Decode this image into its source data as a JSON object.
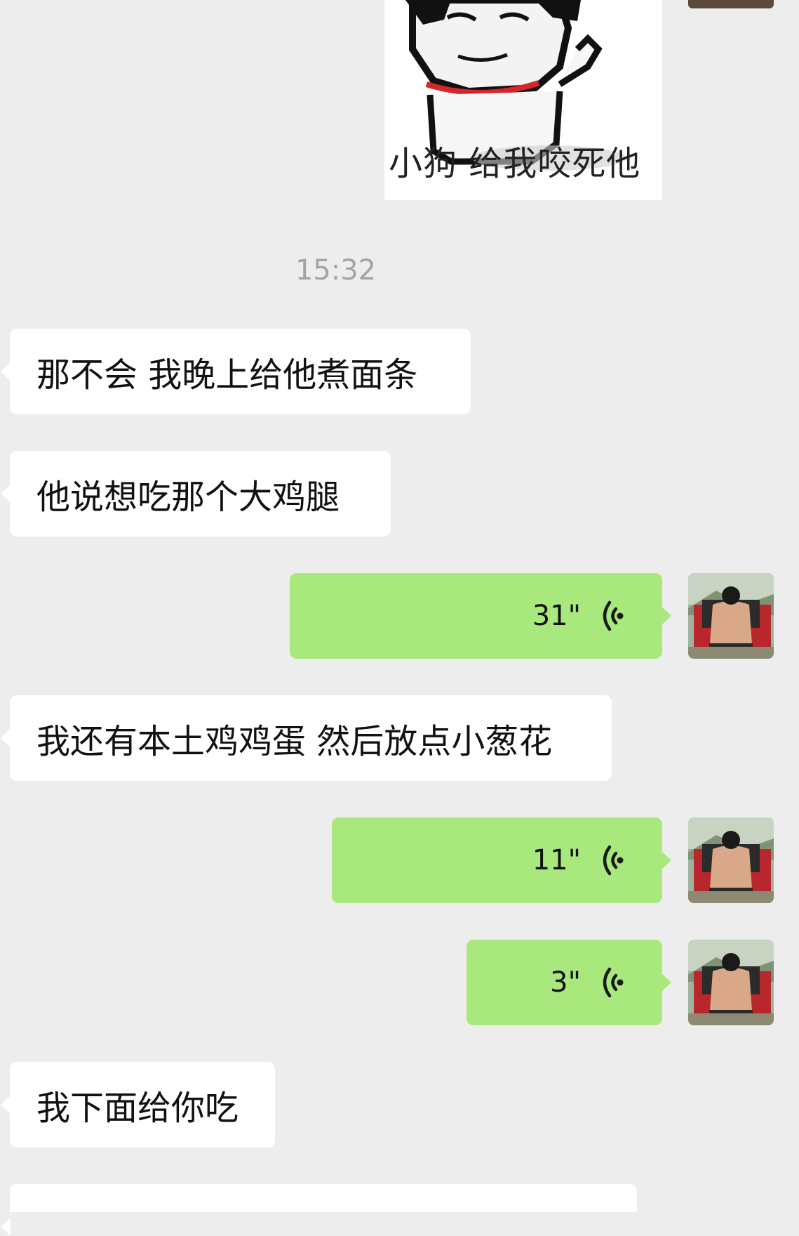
{
  "sticker": {
    "caption": "小狗 给我咬死他"
  },
  "timestamp": "15:32",
  "messages": [
    {
      "text": "那不会 我晚上给他煮面条"
    },
    {
      "text": "他说想吃那个大鸡腿"
    },
    {
      "voice_duration": "31\""
    },
    {
      "text": "我还有本土鸡鸡蛋 然后放点小葱花"
    },
    {
      "voice_duration": "11\""
    },
    {
      "voice_duration": "3\""
    },
    {
      "text": "我下面给你吃"
    }
  ],
  "colors": {
    "background": "#ededed",
    "incoming_bubble": "#ffffff",
    "outgoing_bubble": "#a9e87c",
    "timestamp": "#a3a3a3"
  }
}
